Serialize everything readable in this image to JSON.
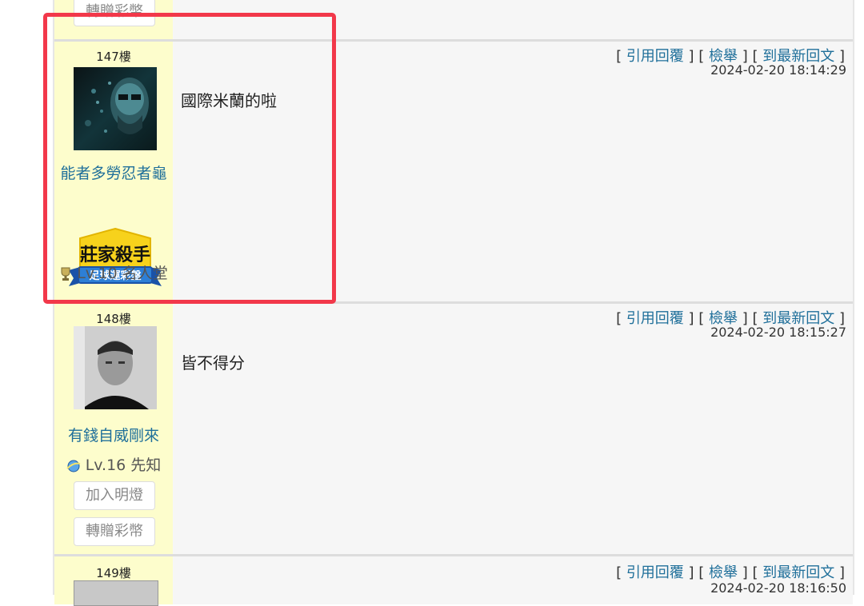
{
  "top_partial": {
    "gift_label": "轉贈彩幣"
  },
  "posts": [
    {
      "floor": "147樓",
      "username": "能者多勞忍者龜",
      "badge_title": "莊家殺手",
      "badge_subtitle": "足球運彩盤",
      "level_text": "Lv.10 名人堂",
      "level_icon": "trophy-icon",
      "actions": {
        "quote": "引用回覆",
        "report": "檢舉",
        "latest": "到最新回文"
      },
      "time": "2024-02-20 18:14:29",
      "message": "國際米蘭的啦"
    },
    {
      "floor": "148樓",
      "username": "有錢自威剛來",
      "level_text": "Lv.16 先知",
      "level_icon": "planet-icon",
      "buttons": {
        "follow": "加入明燈",
        "gift": "轉贈彩幣"
      },
      "actions": {
        "quote": "引用回覆",
        "report": "檢舉",
        "latest": "到最新回文"
      },
      "time": "2024-02-20 18:15:27",
      "message": "皆不得分"
    },
    {
      "floor": "149樓",
      "actions": {
        "quote": "引用回覆",
        "report": "檢舉",
        "latest": "到最新回文"
      },
      "time": "2024-02-20 18:16:50"
    }
  ],
  "colors": {
    "author_bg": "#fdfdcc",
    "link": "#1f6f9a",
    "highlight": "#f2384a"
  }
}
